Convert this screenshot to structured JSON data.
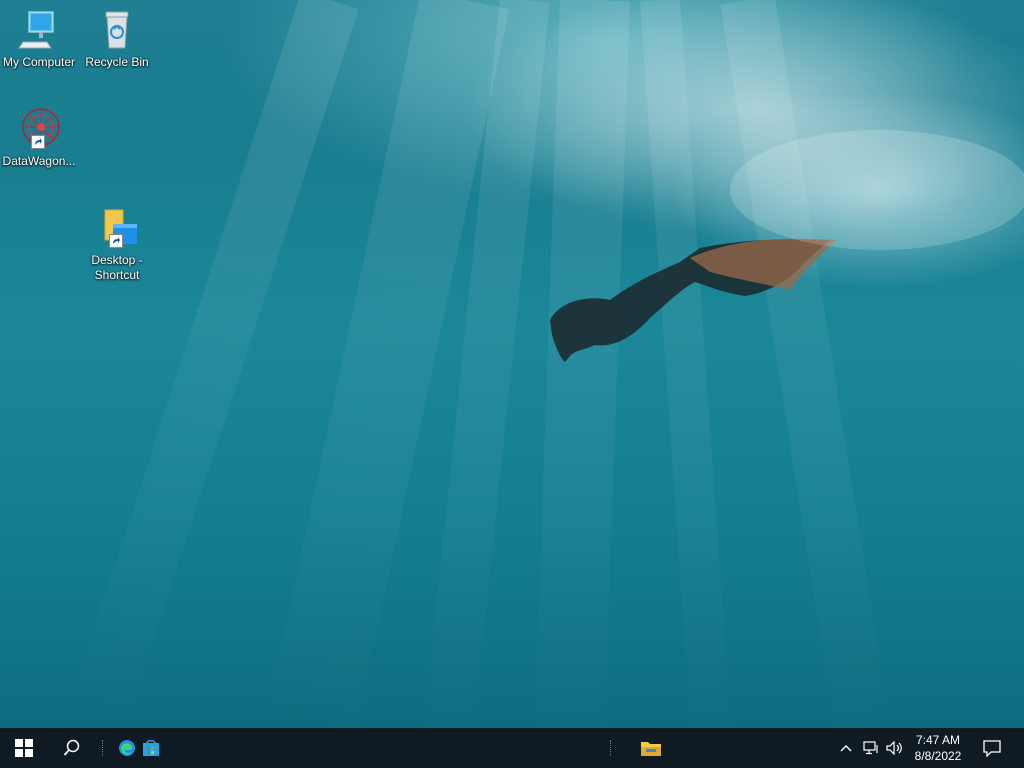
{
  "desktop": {
    "icons": [
      {
        "label": "My Computer",
        "icon": "computer-icon"
      },
      {
        "label": "Recycle Bin",
        "icon": "recycle-bin-icon"
      },
      {
        "label": "DataWagon...",
        "icon": "datawagon-icon"
      },
      {
        "label": "Desktop -\nShortcut",
        "icon": "folder-shortcut-icon"
      }
    ]
  },
  "taskbar": {
    "start": {
      "icon": "windows-logo-icon"
    },
    "search": {
      "icon": "search-icon"
    },
    "pinned": [
      {
        "name": "Microsoft Edge",
        "icon": "edge-icon"
      },
      {
        "name": "Microsoft Store",
        "icon": "store-icon"
      }
    ],
    "running": [
      {
        "name": "File Explorer",
        "icon": "file-explorer-icon"
      }
    ],
    "tray": {
      "icons": [
        "chevron-up-icon",
        "network-icon",
        "volume-icon"
      ],
      "time": "7:47 AM",
      "date": "8/8/2022",
      "notifications_icon": "notification-icon"
    }
  },
  "colors": {
    "taskbar": "#0f1a22",
    "water": "#1a7d90",
    "accent": "#0078d7"
  }
}
